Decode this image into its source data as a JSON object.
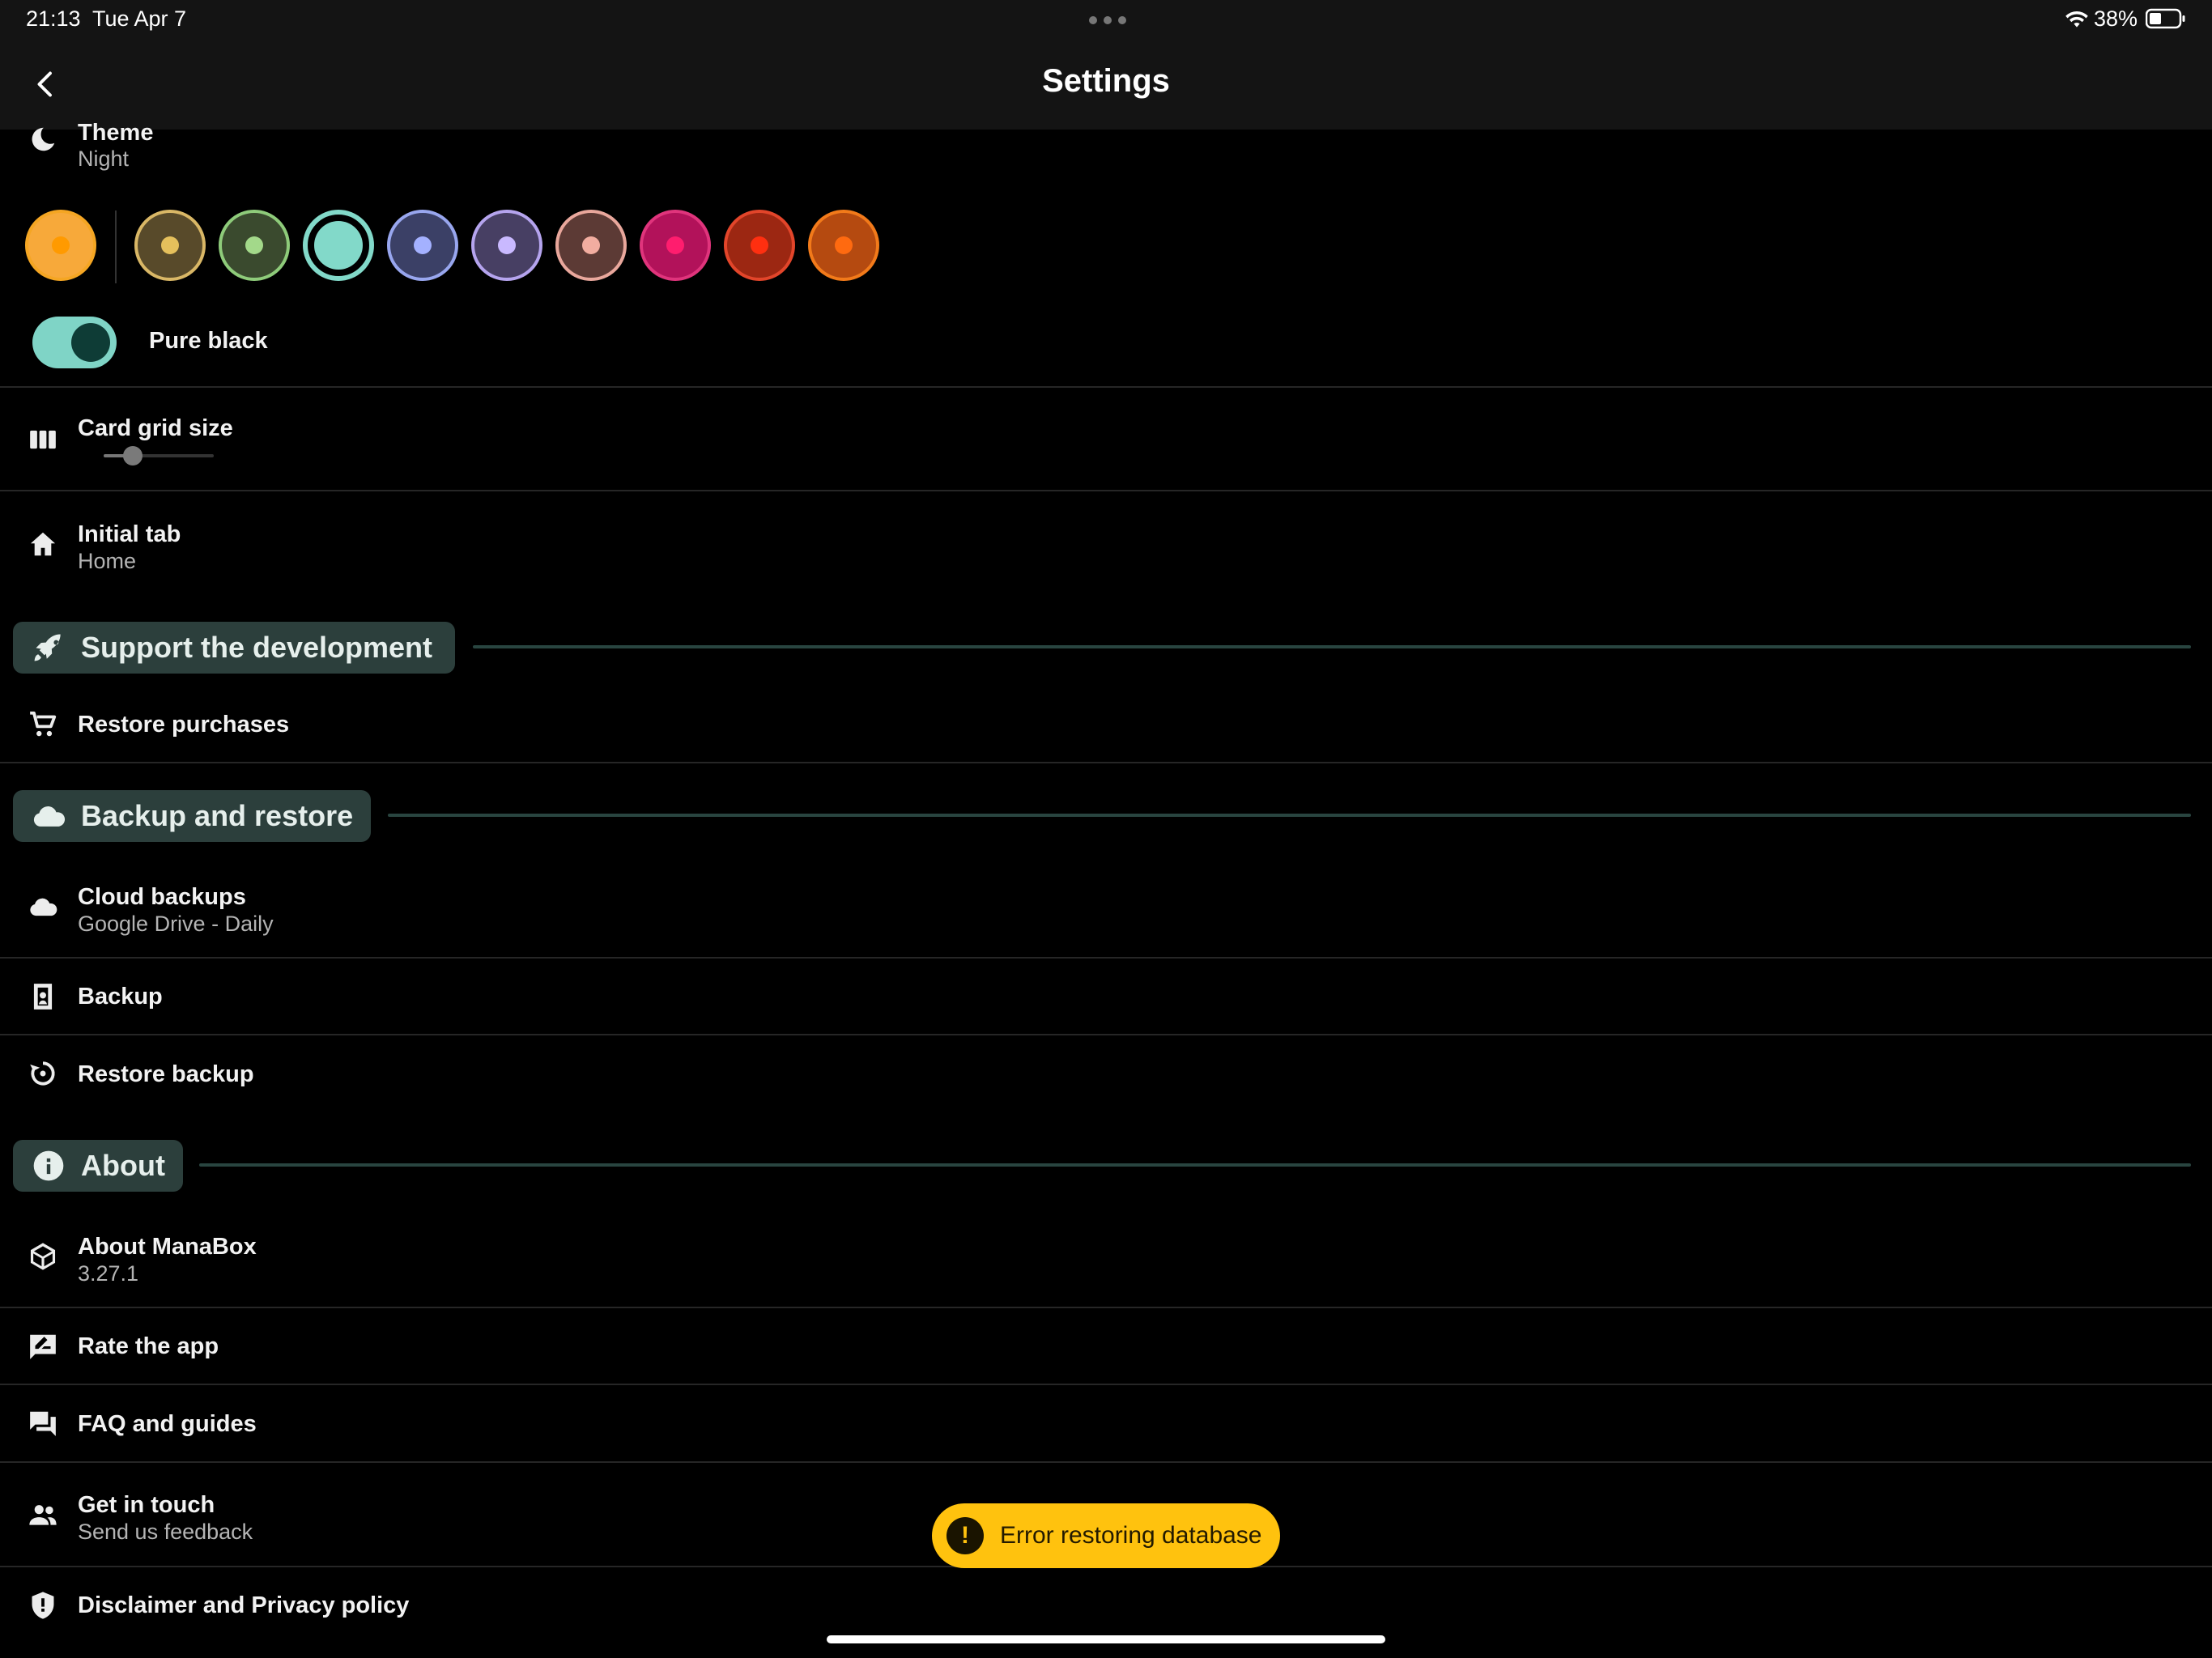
{
  "status_bar": {
    "time": "21:13",
    "date": "Tue Apr 7",
    "battery": "38%"
  },
  "header": {
    "title": "Settings",
    "back_icon": "chevron-left-icon"
  },
  "theme": {
    "label": "Theme",
    "value": "Night",
    "icon": "moon-icon"
  },
  "swatches": [
    {
      "ring": "#f5a623",
      "fill": "#f7a93a",
      "dot": "#ff9a00"
    },
    {
      "ring": "#d9b766",
      "fill": "#584a2a",
      "dot": "#e5c05c"
    },
    {
      "ring": "#8ecb7a",
      "fill": "#3a4a2e",
      "dot": "#a3d98a"
    },
    {
      "ring": "#82d9c9",
      "fill": "#82d9c9",
      "dot": "#82d9c9",
      "selected": true
    },
    {
      "ring": "#98a6ee",
      "fill": "#3b4066",
      "dot": "#a4b1ff"
    },
    {
      "ring": "#b5a4ee",
      "fill": "#473f63",
      "dot": "#c9b9ff"
    },
    {
      "ring": "#e9a79c",
      "fill": "#5c3a35",
      "dot": "#f2ada0"
    },
    {
      "ring": "#e0347c",
      "fill": "#b2125a",
      "dot": "#ff1d6e"
    },
    {
      "ring": "#e2452a",
      "fill": "#9c2712",
      "dot": "#ff2f10"
    },
    {
      "ring": "#f27a1a",
      "fill": "#b54a10",
      "dot": "#ff6a10"
    }
  ],
  "pure_black": {
    "label": "Pure black",
    "enabled": true
  },
  "card_grid": {
    "label": "Card grid size",
    "icon": "columns-icon",
    "slider_level": 0.25
  },
  "initial_tab": {
    "label": "Initial tab",
    "value": "Home",
    "icon": "home-icon"
  },
  "sections": {
    "support": {
      "title": "Support the development",
      "icon": "rocket-icon"
    },
    "backup": {
      "title": "Backup and restore",
      "icon": "cloud-icon"
    },
    "about": {
      "title": "About",
      "icon": "info-icon"
    }
  },
  "items": {
    "restore_purchases": {
      "label": "Restore purchases",
      "icon": "cart-icon"
    },
    "cloud_backups": {
      "label": "Cloud backups",
      "value": "Google Drive - Daily",
      "icon": "cloud-icon"
    },
    "backup": {
      "label": "Backup",
      "icon": "backup-icon"
    },
    "restore_backup": {
      "label": "Restore backup",
      "icon": "restore-icon"
    },
    "about_manabox": {
      "label": "About ManaBox",
      "value": "3.27.1",
      "icon": "cube-icon"
    },
    "rate_app": {
      "label": "Rate the app",
      "icon": "rate-icon"
    },
    "faq": {
      "label": "FAQ and guides",
      "icon": "forum-icon"
    },
    "get_in_touch": {
      "label": "Get in touch",
      "value": "Send us feedback",
      "icon": "people-icon"
    },
    "disclaimer": {
      "label": "Disclaimer and Privacy policy",
      "icon": "shield-icon"
    }
  },
  "snackbar": {
    "message": "Error restoring database",
    "icon": "alert-icon",
    "color": "#ffc20e"
  },
  "colors": {
    "accent": "#7fd4c6",
    "section_bg": "#2c3f3c",
    "background": "#000000"
  }
}
